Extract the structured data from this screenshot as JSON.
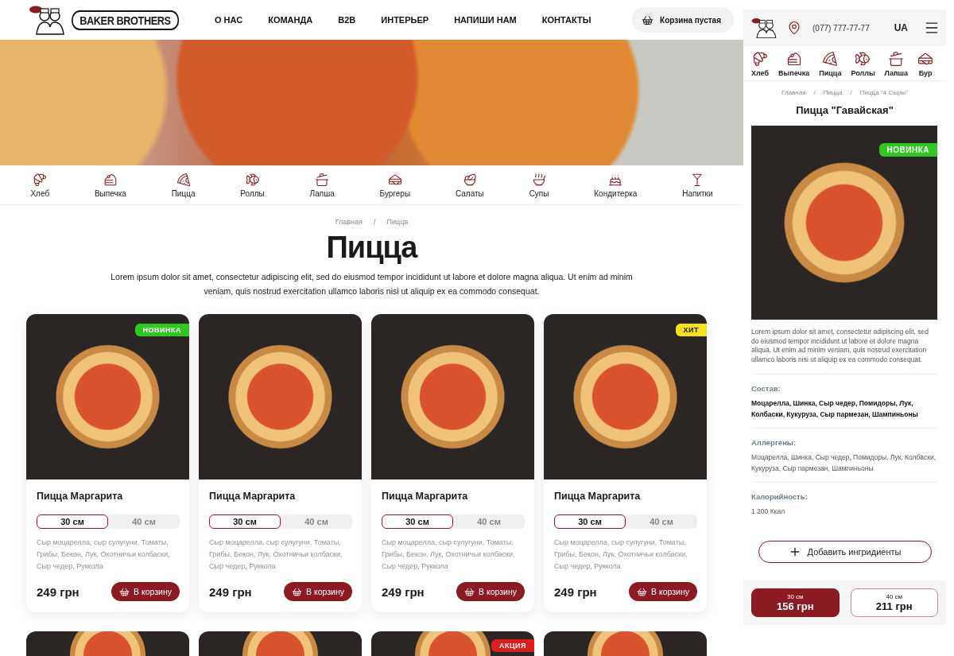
{
  "header": {
    "logo_text": "BAKER BROTHERS",
    "nav": [
      "О НАС",
      "КОМАНДА",
      "B2B",
      "ИНТЕРЬЕР",
      "НАПИШИ НАМ",
      "КОНТАКТЫ"
    ],
    "cart": "Корзина пустая"
  },
  "categories": [
    {
      "label": "Хлеб",
      "kind": "bread"
    },
    {
      "label": "Выпечка",
      "kind": "pastry"
    },
    {
      "label": "Пицца",
      "kind": "pizza"
    },
    {
      "label": "Роллы",
      "kind": "rolls"
    },
    {
      "label": "Лапша",
      "kind": "noodles"
    },
    {
      "label": "Бургеры",
      "kind": "burger"
    },
    {
      "label": "Салаты",
      "kind": "salad"
    },
    {
      "label": "Супы",
      "kind": "soup"
    },
    {
      "label": "Кондитерка",
      "kind": "cake"
    },
    {
      "label": "Напитки",
      "kind": "drink"
    }
  ],
  "breadcrumb": [
    "Главная",
    "Пицца"
  ],
  "breadcrumb_separator": "/",
  "title": "Пицца",
  "intro": "Lorem ipsum dolor sit amet, consectetur adipiscing elit, sed do eiusmod tempor incididunt ut labore et dolore magna aliqua. Ut enim ad minim veniam, quis nostrud exercitation ullamco laboris nisi ut aliquip ex ea commodo consequat.",
  "products": [
    {
      "name": "Пицца Маргарита",
      "badge": {
        "label": "НОВИНКА",
        "kind": "new"
      },
      "sizes": [
        {
          "label": "30 см",
          "selected": true
        },
        {
          "label": "40 см",
          "selected": false
        }
      ],
      "description": "Сыр моцарелла, сыр сулугуни, Томаты, Грибы, Бекон, Лук, Охотничьи колбаски, Сыр чедер, Руккола",
      "price": "249 грн",
      "button": "В корзину"
    },
    {
      "name": "Пицца Маргарита",
      "sizes": [
        {
          "label": "30 см",
          "selected": true
        },
        {
          "label": "40 см",
          "selected": false
        }
      ],
      "description": "Сыр моцарелла, сыр сулугуни, Томаты, Грибы, Бекон, Лук, Охотничьи колбаски, Сыр чедер, Руккола",
      "price": "249 грн",
      "button": "В корзину"
    },
    {
      "name": "Пицца Маргарита",
      "sizes": [
        {
          "label": "30 см",
          "selected": true
        },
        {
          "label": "40 см",
          "selected": false
        }
      ],
      "description": "Сыр моцарелла, сыр сулугуни, Томаты, Грибы, Бекон, Лук, Охотничьи колбаски, Сыр чедер, Руккола",
      "price": "249 грн",
      "button": "В корзину"
    },
    {
      "name": "Пицца Маргарита",
      "badge": {
        "label": "ХИТ",
        "kind": "hit"
      },
      "sizes": [
        {
          "label": "30 см",
          "selected": true
        },
        {
          "label": "40 см",
          "selected": false
        }
      ],
      "description": "Сыр моцарелла, сыр сулугуни, Томаты, Грибы, Бекон, Лук, Охотничьи колбаски, Сыр чедер, Руккола",
      "price": "249 грн",
      "button": "В корзину"
    }
  ],
  "more_products": [
    {
      "photo": true
    },
    {
      "photo": true
    },
    {
      "photo": true,
      "badge": {
        "label": "АКЦИЯ",
        "kind": "sale"
      }
    },
    {
      "photo": true
    }
  ],
  "mobile": {
    "phone": "(077) 777-77-77",
    "language": "UA",
    "categories": [
      {
        "label": "Хлеб",
        "kind": "bread"
      },
      {
        "label": "Выпечка",
        "kind": "pastry"
      },
      {
        "label": "Пицца",
        "kind": "pizza"
      },
      {
        "label": "Роллы",
        "kind": "rolls"
      },
      {
        "label": "Лапша",
        "kind": "noodles"
      },
      {
        "label": "Бур",
        "kind": "burger"
      }
    ],
    "breadcrumb": [
      "Главная",
      "Пицца",
      "Пицца \"4 Сыры\""
    ],
    "breadcrumb_separator": "/",
    "title": "Пицца \"Гавайская\"",
    "badge": {
      "label": "НОВИНКА",
      "kind": "new"
    },
    "description": "Lorem ipsum dolor sit amet, consectetur adipiscing elit, sed do eiusmod tempor incididunt ut labore et dolore magna aliqua. Ut enim ad minim veniam, quis nostrud exercitation ullamco laboris nisi ut aliquip ex ea commodo consequat.",
    "sections": [
      {
        "heading": "Состав:",
        "text": "Моцарелла, Шинка, Сыр чедер, Помидоры, Лук, Колбаски, Кукуруза, Сыр пармезан, Шампиньоны",
        "bold": true
      },
      {
        "heading": "Аллергены:",
        "text": "Моцарелла, Шинка, Сыр чедер, Помидоры, Лук, Колбаски, Кукуруза, Сыр пармезан, Шампиньоны",
        "bold": false
      },
      {
        "heading": "Калорийность:",
        "text": "1 200 Ккал",
        "bold": false
      }
    ],
    "add_button": "Добавить ингридиенты",
    "sizes": [
      {
        "size": "30 см",
        "price": "156 грн",
        "selected": true
      },
      {
        "size": "40 см",
        "price": "211 грн",
        "selected": false
      }
    ]
  }
}
